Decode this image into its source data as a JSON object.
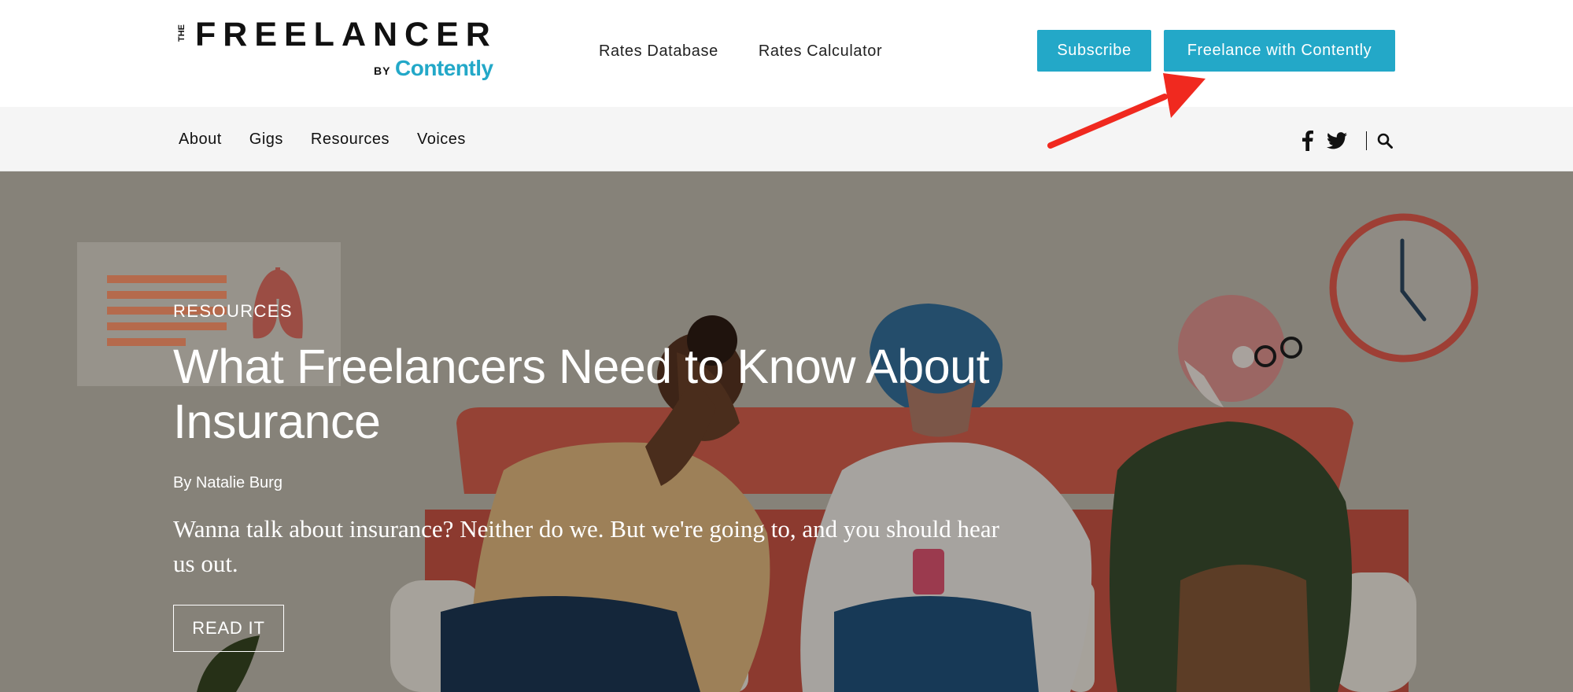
{
  "header": {
    "logo": {
      "the": "THE",
      "wordmark": "FREELANCER",
      "by": "BY",
      "brand": "Contently"
    },
    "links": [
      "Rates Database",
      "Rates Calculator"
    ],
    "subscribe_label": "Subscribe",
    "freelance_label": "Freelance with Contently"
  },
  "subnav": {
    "items": [
      "About",
      "Gigs",
      "Resources",
      "Voices"
    ],
    "icons": [
      "facebook-icon",
      "twitter-icon",
      "search-icon"
    ]
  },
  "hero": {
    "kicker": "RESOURCES",
    "headline": "What Freelancers Need to Know About Insurance",
    "byline": "By Natalie Burg",
    "dek": "Wanna talk about insurance? Neither do we. But we're going to, and you should hear us out.",
    "cta_label": "READ IT"
  },
  "colors": {
    "accent": "#23a8c8",
    "annotation_arrow": "#f0291f",
    "hero_overlay": "#868279",
    "subnav_bg": "#f5f5f5"
  }
}
